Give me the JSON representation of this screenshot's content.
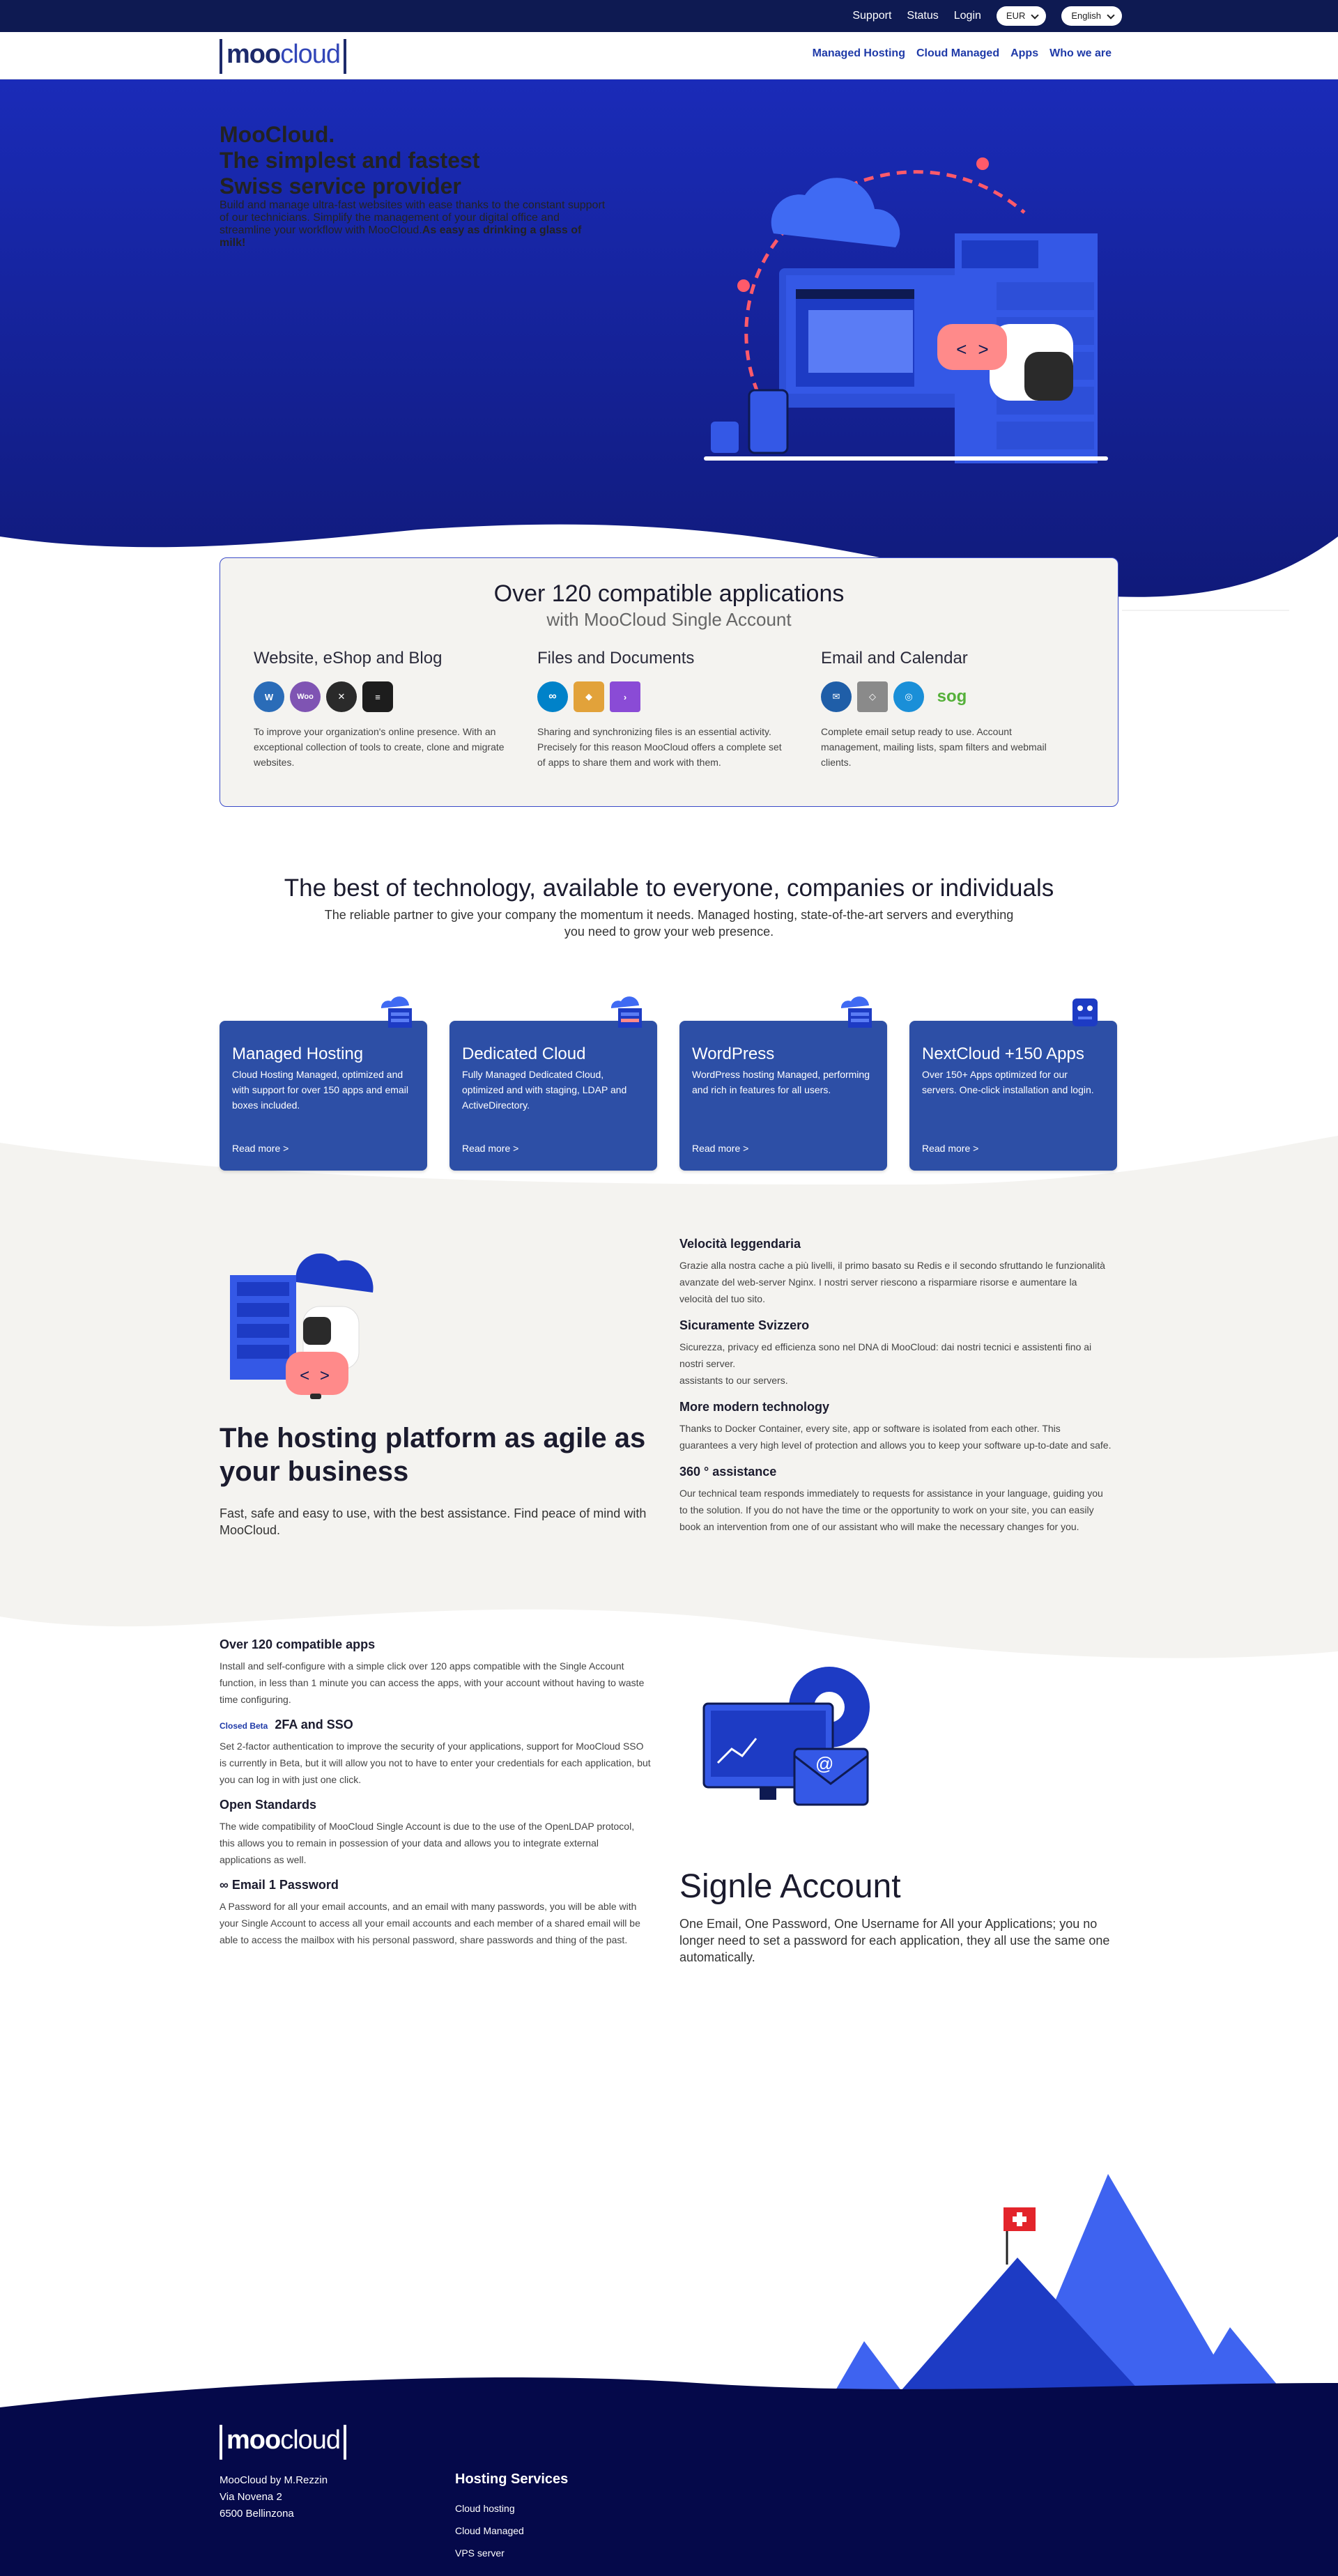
{
  "topbar": {
    "support": "Support",
    "status": "Status",
    "login": "Login",
    "currency": "EUR",
    "language": "English"
  },
  "brand": {
    "logo_a": "moo",
    "logo_b": "cloud"
  },
  "nav": {
    "items": [
      "Managed Hosting",
      "Cloud Managed",
      "Apps",
      "Who we are"
    ]
  },
  "hero": {
    "title_1": "MooCloud.",
    "title_2": "The simplest and fastest",
    "title_3": "Swiss service provider",
    "body": "Build and manage ultra-fast websites with ease thanks to the constant support of our technicians. Simplify the management of your digital office and streamline your workflow with MooCloud.",
    "tagline": "As easy as drinking a glass of milk!"
  },
  "apps_box": {
    "title": "Over 120 compatible applications",
    "subtitle": "with MooCloud Single Account",
    "columns": [
      {
        "title": "Website, eShop and Blog",
        "text": "To improve your organization's online presence. With an exceptional collection of tools to create, clone and migrate websites."
      },
      {
        "title": "Files and Documents",
        "text": "Sharing and synchronizing files is an essential activity. Precisely for this reason MooCloud offers a complete set of apps to share them and work with them."
      },
      {
        "title": "Email and Calendar",
        "text": "Complete email setup ready to use. Account management, mailing lists, spam filters and webmail clients."
      }
    ],
    "icons": [
      "wordpress-icon",
      "woocommerce-icon",
      "joomla-icon",
      "grav-icon",
      "nextcloud-icon",
      "layers-icon",
      "collabora-icon",
      "thunderbird-icon",
      "roundcube-icon",
      "onlyoffice-icon",
      "sogo-icon"
    ],
    "woo_text": "Woo",
    "sogo_text": "sog"
  },
  "tech": {
    "title": "The best of technology, available to everyone, companies or individuals",
    "subtitle": "The reliable partner to give your company the momentum it needs. Managed hosting, state-of-the-art servers and everything you need to grow your web presence."
  },
  "cards": [
    {
      "title": "Managed Hosting",
      "text": "Cloud Hosting Managed, optimized and with support for over 150 apps and email boxes included.",
      "more": "Read more >"
    },
    {
      "title": "Dedicated Cloud",
      "text": "Fully Managed Dedicated Cloud, optimized and with staging, LDAP and ActiveDirectory.",
      "more": "Read more >"
    },
    {
      "title": "WordPress",
      "text": "WordPress hosting Managed, performing and rich in features for all users.",
      "more": "Read more >"
    },
    {
      "title": "NextCloud +150 Apps",
      "text": "Over 150+ Apps optimized for our servers. One-click installation and login.",
      "more": "Read more >"
    }
  ],
  "agile": {
    "title": "The hosting platform as agile as your business",
    "text": "Fast, safe and easy to use, with the best assistance. Find peace of mind with MooCloud."
  },
  "features": [
    {
      "title": "Velocità leggendaria",
      "text": "Grazie alla nostra cache a più livelli, il primo basato su Redis e il secondo sfruttando le funzionalità avanzate del web-server Nginx. I nostri server riescono a risparmiare risorse e aumentare la velocità del tuo sito."
    },
    {
      "title": "Sicuramente Svizzero",
      "text": "Sicurezza, privacy ed efficienza sono nel DNA di MooCloud: dai nostri tecnici e assistenti fino ai nostri server.",
      "text2": "assistants to our servers."
    },
    {
      "title": "More modern technology",
      "text": "Thanks to Docker Container, every site, app or software is isolated from each other. This guarantees a very high level of protection and allows you to keep your software up-to-date and safe."
    },
    {
      "title": "360 ° assistance",
      "text": "Our technical team responds immediately to requests for assistance in your language, guiding you to the solution. If you do not have the time or the opportunity to work on your site, you can easily book an intervention from one of our assistant who will make the necessary changes for you."
    }
  ],
  "features2": [
    {
      "title": "Over 120 compatible apps",
      "text": "Install and self-configure with a simple click over 120 apps compatible with the Single Account function, in less than 1 minute you can access the apps, with your account without having to waste time configuring."
    },
    {
      "badge": "Closed Beta",
      "title": "2FA and SSO",
      "text": "Set 2-factor authentication to improve the security of your applications, support for MooCloud SSO is currently in Beta, but it will allow you not to have to enter your credentials for each application, but you can log in with just one click."
    },
    {
      "title": "Open Standards",
      "text": "The wide compatibility of MooCloud Single Account is due to the use of the OpenLDAP protocol, this allows you to remain in possession of your data and allows you to integrate external applications as well."
    },
    {
      "title": "∞ Email 1 Password",
      "text": "A Password for all your email accounts, and an email with many passwords, you will be able with your Single Account to access all your email accounts and each member of a shared email will be able to access the mailbox with his personal password, share passwords and thing of the past."
    }
  ],
  "signle": {
    "title": "Signle Account",
    "text": "One Email, One Password, One Username for All your Applications; you no longer need to set a password for each application, they all use the same one automatically."
  },
  "footer": {
    "company": "MooCloud by M.Rezzin",
    "street": "Via Novena 2",
    "city": "6500 Bellinzona",
    "col_title": "Hosting Services",
    "links": [
      "Cloud hosting",
      "Cloud Managed",
      "VPS server"
    ]
  },
  "colors": {
    "navy": "#0e1a52",
    "hero_blue": "#1a2bb8",
    "card_blue": "#2d4fa6",
    "accent": "#1f3aa8",
    "cream": "#f4f3f0"
  }
}
